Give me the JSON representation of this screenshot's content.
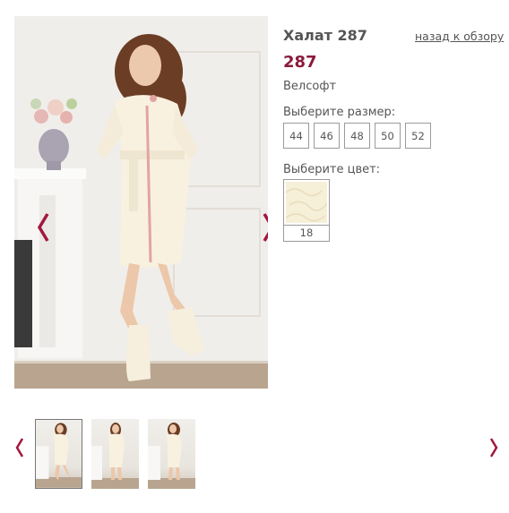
{
  "product": {
    "title": "Халат 287",
    "price": "287",
    "fabric": "Велсофт",
    "back_link": "назад к обзору"
  },
  "size_picker": {
    "label": "Выберите размер:",
    "sizes": [
      "44",
      "46",
      "48",
      "50",
      "52"
    ]
  },
  "color_picker": {
    "label": "Выберите цвет:",
    "colors": [
      {
        "name": "18",
        "swatch_color": "#f7f0d9"
      }
    ]
  },
  "gallery": {
    "prev_icon": "chevron-left-icon",
    "next_icon": "chevron-right-icon",
    "thumbnail_count": 3
  },
  "colors": {
    "accent": "#a3173f",
    "price": "#8b1a3c",
    "text": "#555555",
    "border": "#9a9a9a"
  }
}
